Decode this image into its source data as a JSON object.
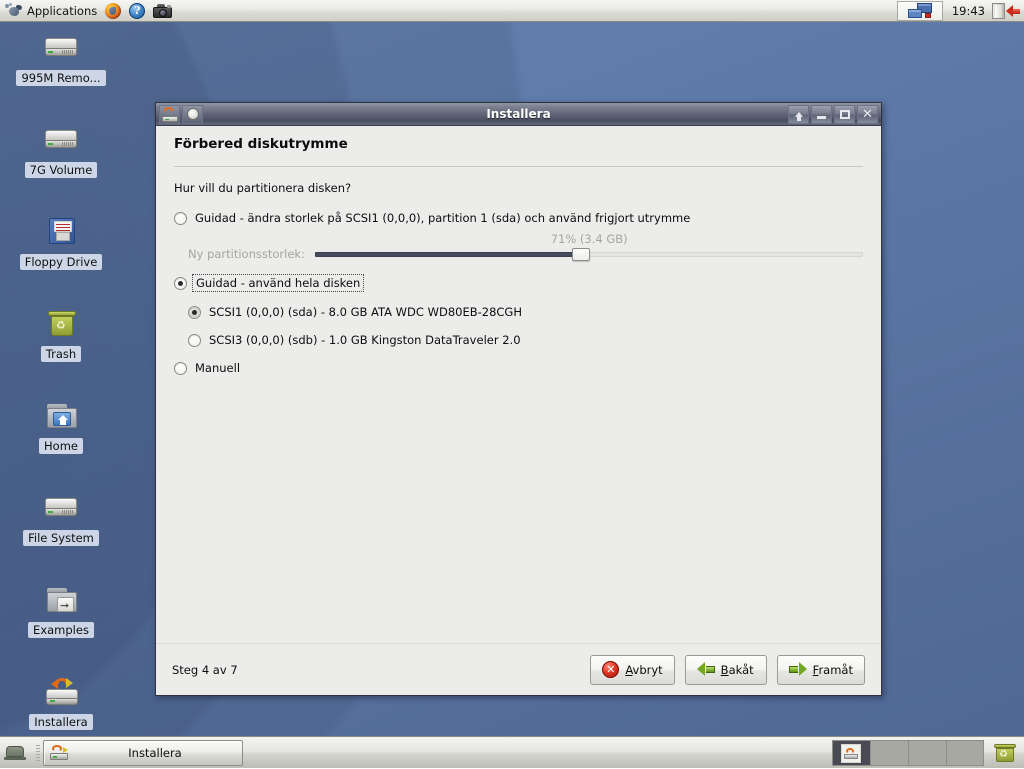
{
  "top_panel": {
    "applications_label": "Applications",
    "icons": [
      "gnome-foot-icon",
      "firefox-icon",
      "help-icon",
      "camera-icon"
    ],
    "help_glyph": "?",
    "clock": "19:43",
    "workspace_applet_name": "window-list-icon",
    "logout_label": "logout-icon"
  },
  "desktop_icons": [
    {
      "name": "removable-drive",
      "label": "995M Remo...",
      "icon": "hdd-icon"
    },
    {
      "name": "volume-7g",
      "label": "7G Volume",
      "icon": "hdd-icon"
    },
    {
      "name": "floppy-drive",
      "label": "Floppy Drive",
      "icon": "floppy-icon"
    },
    {
      "name": "trash",
      "label": "Trash",
      "icon": "trash-icon"
    },
    {
      "name": "home",
      "label": "Home",
      "icon": "home-folder-icon"
    },
    {
      "name": "file-system",
      "label": "File System",
      "icon": "hdd-icon"
    },
    {
      "name": "examples",
      "label": "Examples",
      "icon": "examples-folder-icon"
    },
    {
      "name": "installer",
      "label": "Installera",
      "icon": "installer-icon"
    }
  ],
  "window": {
    "title": "Installera",
    "titlebar_buttons": [
      "shade-button",
      "minimize-button",
      "maximize-button",
      "close-button"
    ],
    "close_glyph": "✕",
    "page_title": "Förbered diskutrymme",
    "question": "Hur vill du partitionera disken?",
    "options": [
      {
        "id": "resize",
        "label": "Guidad - ändra storlek på SCSI1 (0,0,0), partition 1 (sda) och använd frigjort utrymme",
        "selected": false
      },
      {
        "id": "whole-disk",
        "label": "Guidad - använd hela disken",
        "selected": true
      },
      {
        "id": "manual",
        "label": "Manuell",
        "selected": false
      }
    ],
    "disks": [
      {
        "id": "sda",
        "label": "SCSI1 (0,0,0) (sda) - 8.0 GB ATA WDC WD80EB-28CGH",
        "selected": true
      },
      {
        "id": "sdb",
        "label": "SCSI3 (0,0,0) (sdb) - 1.0 GB Kingston DataTraveler 2.0",
        "selected": false
      }
    ],
    "slider": {
      "label": "Ny partitionsstorlek:",
      "value_text": "71% (3.4 GB)",
      "percent": 71
    },
    "footer": {
      "step_text": "Steg 4 av 7",
      "buttons": [
        {
          "id": "cancel",
          "label_before": "",
          "label_accel": "A",
          "label_after": "vbryt",
          "icon": "cancel-x-icon"
        },
        {
          "id": "back",
          "label_before": "",
          "label_accel": "B",
          "label_after": "akåt",
          "icon": "left-arrow-icon"
        },
        {
          "id": "forward",
          "label_before": "",
          "label_accel": "F",
          "label_after": "ramåt",
          "icon": "right-arrow-icon"
        }
      ]
    }
  },
  "bottom_panel": {
    "show_desktop_name": "show-desktop-button",
    "tasks": [
      {
        "label": "Installera",
        "active": true
      }
    ],
    "workspaces": [
      {
        "index": 1,
        "active": true
      },
      {
        "index": 2,
        "active": false
      },
      {
        "index": 3,
        "active": false
      },
      {
        "index": 4,
        "active": false
      }
    ],
    "trash_applet_name": "trash-applet"
  },
  "colors": {
    "desktop_blue": "#5d79a8",
    "titlebar_dark": "#5c6273",
    "dialog_bg": "#ececeb",
    "slider_fill": "#474b5e",
    "accent_green": "#74a822",
    "accent_red": "#e03a28"
  }
}
